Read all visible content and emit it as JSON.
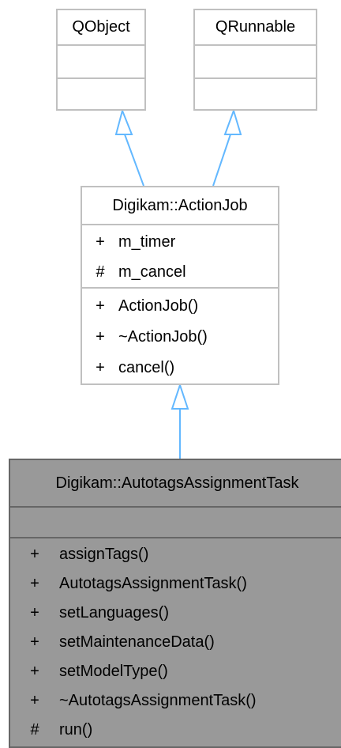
{
  "colors": {
    "arrow": "#63b8ff",
    "border_light": "#c0c0c0",
    "border_dark": "#666666",
    "focus_fill": "#999999"
  },
  "classes": {
    "qobject": {
      "name": "QObject"
    },
    "qrunnable": {
      "name": "QRunnable"
    },
    "action_job": {
      "name": "Digikam::ActionJob",
      "attributes": [
        {
          "vis": "+",
          "name": "m_timer"
        },
        {
          "vis": "#",
          "name": "m_cancel"
        }
      ],
      "methods": [
        {
          "vis": "+",
          "name": "ActionJob()"
        },
        {
          "vis": "+",
          "name": "~ActionJob()"
        },
        {
          "vis": "+",
          "name": "cancel()"
        }
      ]
    },
    "autotags_task": {
      "name": "Digikam::AutotagsAssignmentTask",
      "methods": [
        {
          "vis": "+",
          "name": "assignTags()"
        },
        {
          "vis": "+",
          "name": "AutotagsAssignmentTask()"
        },
        {
          "vis": "+",
          "name": "setLanguages()"
        },
        {
          "vis": "+",
          "name": "setMaintenanceData()"
        },
        {
          "vis": "+",
          "name": "setModelType()"
        },
        {
          "vis": "+",
          "name": "~AutotagsAssignmentTask()"
        },
        {
          "vis": "#",
          "name": "run()"
        }
      ]
    }
  }
}
